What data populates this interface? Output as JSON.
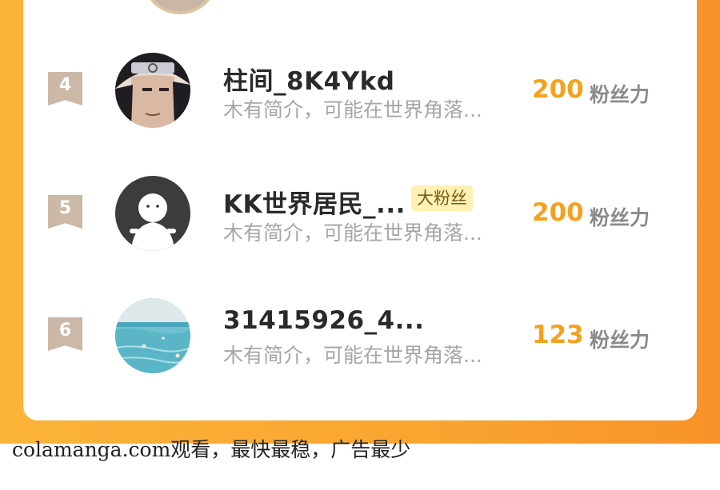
{
  "colors": {
    "accent": "#f4a21e",
    "background": "#f9a530",
    "rank_badge": "#ccb8a7"
  },
  "rows": [
    {
      "rank": "4",
      "name": "柱间_8K4Ykd",
      "bio": "木有简介，可能在世界角落...",
      "score": "200",
      "unit": "粉丝力",
      "avatar_icon": "anime-ninja-avatar"
    },
    {
      "rank": "5",
      "name": "KK世界居民_...",
      "badge": "大粉丝",
      "bio": "木有简介，可能在世界角落...",
      "score": "200",
      "unit": "粉丝力",
      "avatar_icon": "default-user-avatar"
    },
    {
      "rank": "6",
      "name": "31415926_4...",
      "bio": "木有简介，可能在世界角落...",
      "score": "123",
      "unit": "粉丝力",
      "avatar_icon": "beach-photo-avatar"
    }
  ],
  "watermark": "colamanga.com观看，最快最稳，广告最少"
}
